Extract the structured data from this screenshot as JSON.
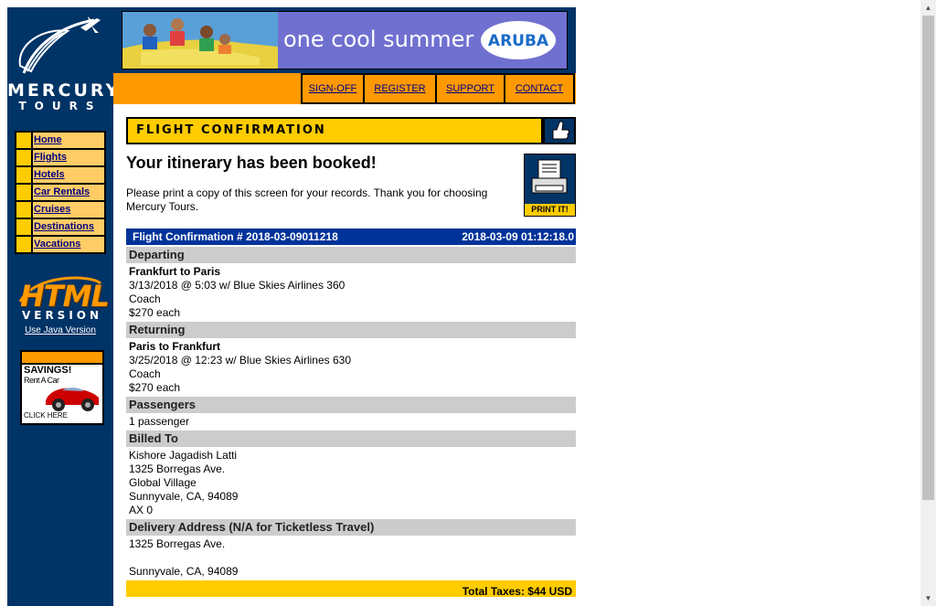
{
  "brand": {
    "name_line1": "MERCURY",
    "name_line2": "TOURS"
  },
  "sidebar": {
    "nav": [
      "Home",
      "Flights",
      "Hotels",
      "Car Rentals",
      "Cruises",
      "Destinations",
      "Vacations"
    ],
    "html_logo": "HTML",
    "html_version": "VERSION",
    "java_link": "Use Java Version",
    "ad": {
      "title": "SAVINGS!",
      "subtitle": "Rent A Car",
      "cta": "CLICK HERE"
    }
  },
  "banner": {
    "tagline": "one cool summer",
    "brand": "ARUBA"
  },
  "topnav": [
    "SIGN-OFF",
    "REGISTER",
    "SUPPORT",
    "CONTACT"
  ],
  "page": {
    "section_title": "FLIGHT CONFIRMATION",
    "heading": "Your itinerary has been booked!",
    "message": "Please print a copy of this screen for your records. Thank you for choosing Mercury Tours.",
    "print_label": "PRINT IT!"
  },
  "confirmation": {
    "number_label": "Flight Confirmation # 2018-03-09011218",
    "timestamp": "2018-03-09 01:12:18.0",
    "departing": {
      "heading": "Departing",
      "route": "Frankfurt to Paris",
      "flight": "3/13/2018 @ 5:03 w/ Blue Skies Airlines 360",
      "class": "Coach",
      "price": "$270 each"
    },
    "returning": {
      "heading": "Returning",
      "route": "Paris to Frankfurt",
      "flight": "3/25/2018 @ 12:23 w/ Blue Skies Airlines 630",
      "class": "Coach",
      "price": "$270 each"
    },
    "passengers": {
      "heading": "Passengers",
      "value": "1 passenger"
    },
    "billed_to": {
      "heading": "Billed To",
      "lines": [
        "Kishore Jagadish Latti",
        "1325 Borregas Ave.",
        "Global Village",
        "Sunnyvale, CA, 94089",
        "AX 0"
      ]
    },
    "delivery": {
      "heading": "Delivery Address (N/A for Ticketless Travel)",
      "lines": [
        "1325 Borregas Ave.",
        "",
        "Sunnyvale, CA, 94089"
      ]
    },
    "total_taxes": "Total Taxes:    $44 USD"
  },
  "colors": {
    "sidebar": "#003366",
    "accent_orange": "#ff9900",
    "accent_yellow": "#ffcc00",
    "header_blue": "#003399"
  }
}
